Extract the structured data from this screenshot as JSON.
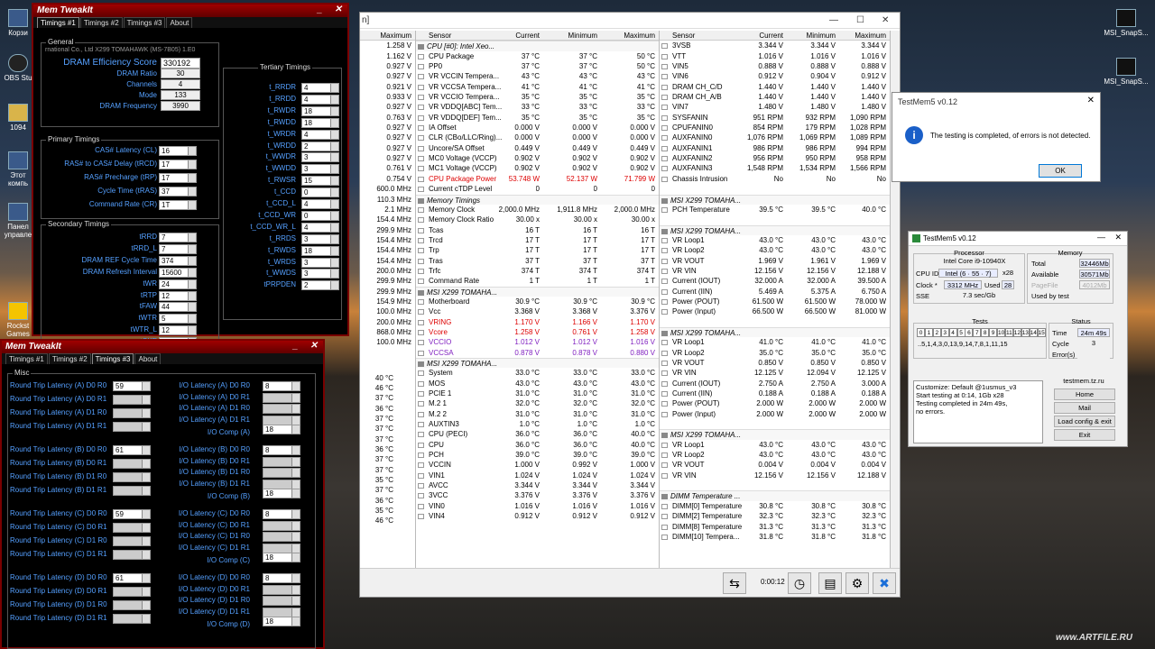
{
  "desktop": {
    "icons": [
      "Корзи",
      "OBS Stu",
      "1094",
      "Этот компь",
      "Панел управле",
      "Rockst Games"
    ],
    "right_icons": [
      "MSI_SnapS...",
      "MSI_SnapS..."
    ],
    "watermark": "www.ARTFILE.RU"
  },
  "hwinfo": {
    "title_frag": "n]",
    "clock": "0:00:12",
    "colA": {
      "hdr": "Maximum",
      "vals": [
        "1.258 V",
        "1.162 V",
        "0.927 V",
        "0.927 V",
        "0.921 V",
        "0.933 V",
        "0.927 V",
        "0.763 V",
        "0.927 V",
        "0.927 V",
        "0.927 V",
        "0.927 V",
        "0.761 V",
        "0.754 V",
        "600.0 MHz",
        "110.3 MHz",
        "2.1 MHz",
        "154.4 MHz",
        "299.9 MHz",
        "154.4 MHz",
        "154.4 MHz",
        "154.4 MHz",
        "200.0 MHz",
        "299.9 MHz",
        "299.9 MHz",
        "154.9 MHz",
        "100.0 MHz",
        "200.0 MHz",
        "868.0 MHz",
        "100.0 MHz"
      ]
    },
    "colA2": [
      "40 °C",
      "46 °C",
      "37 °C",
      "36 °C",
      "37 °C",
      "37 °C",
      "37 °C",
      "36 °C",
      "37 °C",
      "37 °C",
      "35 °C",
      "37 °C",
      "36 °C",
      "35 °C",
      "46 °C"
    ],
    "col1": {
      "hdr": [
        "Sensor",
        "Current",
        "Minimum",
        "Maximum"
      ],
      "rows": [
        {
          "g": "CPU [#0]: Intel Xeo..."
        },
        [
          "CPU Package",
          "37 °C",
          "37 °C",
          "50 °C"
        ],
        [
          "PP0",
          "37 °C",
          "37 °C",
          "50 °C"
        ],
        [
          "VR VCCIN Tempera...",
          "43 °C",
          "43 °C",
          "43 °C"
        ],
        [
          "VR VCCSA Tempera...",
          "41 °C",
          "41 °C",
          "41 °C"
        ],
        [
          "VR VCCIO Tempera...",
          "35 °C",
          "35 °C",
          "35 °C"
        ],
        [
          "VR VDDQ[ABC] Tem...",
          "33 °C",
          "33 °C",
          "33 °C"
        ],
        [
          "VR VDDQ[DEF] Tem...",
          "35 °C",
          "35 °C",
          "35 °C"
        ],
        [
          "IA Offset",
          "0.000 V",
          "0.000 V",
          "0.000 V"
        ],
        [
          "CLR (CBo/LLC/Ring)...",
          "0.000 V",
          "0.000 V",
          "0.000 V"
        ],
        [
          "Uncore/SA Offset",
          "0.449 V",
          "0.449 V",
          "0.449 V"
        ],
        [
          "MC0 Voltage (VCCP)",
          "0.902 V",
          "0.902 V",
          "0.902 V"
        ],
        [
          "MC1 Voltage (VCCP)",
          "0.902 V",
          "0.902 V",
          "0.902 V"
        ],
        {
          "c": "red",
          "r": [
            "CPU Package Power",
            "53.748 W",
            "52.137 W",
            "71.799 W"
          ]
        },
        [
          "Current cTDP Level",
          "0",
          "0",
          "0"
        ],
        {
          "g": "Memory Timings"
        },
        [
          "Memory Clock",
          "2,000.0 MHz",
          "1,911.8 MHz",
          "2,000.0 MHz"
        ],
        [
          "Memory Clock Ratio",
          "30.00 x",
          "30.00 x",
          "30.00 x"
        ],
        [
          "Tcas",
          "16 T",
          "16 T",
          "16 T"
        ],
        [
          "Trcd",
          "17 T",
          "17 T",
          "17 T"
        ],
        [
          "Trp",
          "17 T",
          "17 T",
          "17 T"
        ],
        [
          "Tras",
          "37 T",
          "37 T",
          "37 T"
        ],
        [
          "Trfc",
          "374 T",
          "374 T",
          "374 T"
        ],
        [
          "Command Rate",
          "1 T",
          "1 T",
          "1 T"
        ],
        {
          "g": "MSI X299 TOMAHA..."
        },
        [
          "Motherboard",
          "30.9 °C",
          "30.9 °C",
          "30.9 °C"
        ],
        [
          "Vcc",
          "3.368 V",
          "3.368 V",
          "3.376 V"
        ],
        {
          "c": "red",
          "r": [
            "VRING",
            "1.170 V",
            "1.166 V",
            "1.170 V"
          ]
        },
        {
          "c": "red",
          "r": [
            "Vcore",
            "1.258 V",
            "0.761 V",
            "1.258 V"
          ]
        },
        {
          "c": "pur",
          "r": [
            "VCCIO",
            "1.012 V",
            "1.012 V",
            "1.016 V"
          ]
        },
        {
          "c": "pur",
          "r": [
            "VCCSA",
            "0.878 V",
            "0.878 V",
            "0.880 V"
          ]
        },
        {
          "g": "MSI X299 TOMAHA..."
        },
        [
          "System",
          "33.0 °C",
          "33.0 °C",
          "33.0 °C"
        ],
        [
          "MOS",
          "43.0 °C",
          "43.0 °C",
          "43.0 °C"
        ],
        [
          "PCIE 1",
          "31.0 °C",
          "31.0 °C",
          "31.0 °C"
        ],
        [
          "M.2 1",
          "32.0 °C",
          "32.0 °C",
          "32.0 °C"
        ],
        [
          "M.2 2",
          "31.0 °C",
          "31.0 °C",
          "31.0 °C"
        ],
        [
          "AUXTIN3",
          "1.0 °C",
          "1.0 °C",
          "1.0 °C"
        ],
        [
          "CPU (PECI)",
          "36.0 °C",
          "36.0 °C",
          "40.0 °C"
        ],
        [
          "CPU",
          "36.0 °C",
          "36.0 °C",
          "40.0 °C"
        ],
        [
          "PCH",
          "39.0 °C",
          "39.0 °C",
          "39.0 °C"
        ],
        [
          "VCCIN",
          "1.000 V",
          "0.992 V",
          "1.000 V"
        ],
        [
          "VIN1",
          "1.024 V",
          "1.024 V",
          "1.024 V"
        ],
        [
          "AVCC",
          "3.344 V",
          "3.344 V",
          "3.344 V"
        ],
        [
          "3VCC",
          "3.376 V",
          "3.376 V",
          "3.376 V"
        ],
        [
          "VIN0",
          "1.016 V",
          "1.016 V",
          "1.016 V"
        ],
        [
          "VIN4",
          "0.912 V",
          "0.912 V",
          "0.912 V"
        ]
      ]
    },
    "col2": {
      "hdr": [
        "Sensor",
        "Current",
        "Minimum",
        "Maximum"
      ],
      "rows": [
        [
          "3VSB",
          "3.344 V",
          "3.344 V",
          "3.344 V"
        ],
        [
          "VTT",
          "1.016 V",
          "1.016 V",
          "1.016 V"
        ],
        [
          "VIN5",
          "0.888 V",
          "0.888 V",
          "0.888 V"
        ],
        [
          "VIN6",
          "0.912 V",
          "0.904 V",
          "0.912 V"
        ],
        [
          "DRAM CH_C/D",
          "1.440 V",
          "1.440 V",
          "1.440 V"
        ],
        [
          "DRAM CH_A/B",
          "1.440 V",
          "1.440 V",
          "1.440 V"
        ],
        [
          "VIN7",
          "1.480 V",
          "1.480 V",
          "1.480 V"
        ],
        [
          "SYSFANIN",
          "951 RPM",
          "932 RPM",
          "1,090 RPM"
        ],
        [
          "CPUFANIN0",
          "854 RPM",
          "179 RPM",
          "1,028 RPM"
        ],
        [
          "AUXFANIN0",
          "1,076 RPM",
          "1,069 RPM",
          "1,089 RPM"
        ],
        [
          "AUXFANIN1",
          "986 RPM",
          "986 RPM",
          "994 RPM"
        ],
        [
          "AUXFANIN2",
          "956 RPM",
          "950 RPM",
          "958 RPM"
        ],
        [
          "AUXFANIN3",
          "1,548 RPM",
          "1,534 RPM",
          "1,566 RPM"
        ],
        [
          "Chassis Intrusion",
          "No",
          "No",
          "No"
        ],
        {
          "sp": 1
        },
        {
          "g": "MSI X299 TOMAHA..."
        },
        [
          "PCH Temperature",
          "39.5 °C",
          "39.5 °C",
          "40.0 °C"
        ],
        {
          "sp": 1
        },
        {
          "g": "MSI X299 TOMAHA..."
        },
        [
          "VR Loop1",
          "43.0 °C",
          "43.0 °C",
          "43.0 °C"
        ],
        [
          "VR Loop2",
          "43.0 °C",
          "43.0 °C",
          "43.0 °C"
        ],
        [
          "VR VOUT",
          "1.969 V",
          "1.961 V",
          "1.969 V"
        ],
        [
          "VR VIN",
          "12.156 V",
          "12.156 V",
          "12.188 V"
        ],
        [
          "Current (IOUT)",
          "32.000 A",
          "32.000 A",
          "39.500 A"
        ],
        [
          "Current (IIN)",
          "5.469 A",
          "5.375 A",
          "6.750 A"
        ],
        [
          "Power (POUT)",
          "61.500 W",
          "61.500 W",
          "78.000 W"
        ],
        [
          "Power (Input)",
          "66.500 W",
          "66.500 W",
          "81.000 W"
        ],
        {
          "sp": 1
        },
        {
          "g": "MSI X299 TOMAHA..."
        },
        [
          "VR Loop1",
          "41.0 °C",
          "41.0 °C",
          "41.0 °C"
        ],
        [
          "VR Loop2",
          "35.0 °C",
          "35.0 °C",
          "35.0 °C"
        ],
        [
          "VR VOUT",
          "0.850 V",
          "0.850 V",
          "0.850 V"
        ],
        [
          "VR VIN",
          "12.125 V",
          "12.094 V",
          "12.125 V"
        ],
        [
          "Current (IOUT)",
          "2.750 A",
          "2.750 A",
          "3.000 A"
        ],
        [
          "Current (IIN)",
          "0.188 A",
          "0.188 A",
          "0.188 A"
        ],
        [
          "Power (POUT)",
          "2.000 W",
          "2.000 W",
          "2.000 W"
        ],
        [
          "Power (Input)",
          "2.000 W",
          "2.000 W",
          "2.000 W"
        ],
        {
          "sp": 1
        },
        {
          "g": "MSI X299 TOMAHA..."
        },
        [
          "VR Loop1",
          "43.0 °C",
          "43.0 °C",
          "43.0 °C"
        ],
        [
          "VR Loop2",
          "43.0 °C",
          "43.0 °C",
          "43.0 °C"
        ],
        [
          "VR VOUT",
          "0.004 V",
          "0.004 V",
          "0.004 V"
        ],
        [
          "VR VIN",
          "12.156 V",
          "12.156 V",
          "12.188 V"
        ],
        {
          "sp": 1
        },
        {
          "g": "DIMM Temperature ..."
        },
        [
          "DIMM[0] Temperature",
          "30.8 °C",
          "30.8 °C",
          "30.8 °C"
        ],
        [
          "DIMM[2] Temperature",
          "32.3 °C",
          "32.3 °C",
          "32.3 °C"
        ],
        [
          "DIMM[8] Temperature",
          "31.3 °C",
          "31.3 °C",
          "31.3 °C"
        ],
        [
          "DIMM[10] Tempera...",
          "31.8 °C",
          "31.8 °C",
          "31.8 °C"
        ]
      ]
    }
  },
  "mt1": {
    "title": "Mem TweakIt",
    "tabs": [
      "Timings #1",
      "Timings #2",
      "Timings #3",
      "About"
    ],
    "general_legend": "General",
    "board": "rnational Co., Ltd X299 TOMAHAWK (MS-7B05) 1.E0",
    "general": [
      [
        "DRAM Efficiency Score",
        "330192"
      ],
      [
        "DRAM Ratio",
        "30"
      ],
      [
        "Channels",
        "4"
      ],
      [
        "Mode",
        "133"
      ],
      [
        "DRAM Frequency",
        "3990"
      ]
    ],
    "primary_legend": "Primary Timings",
    "primary": [
      [
        "CAS# Latency (CL)",
        "16"
      ],
      [
        "RAS# to CAS# Delay (tRCD)",
        "17"
      ],
      [
        "RAS# Precharge (tRP)",
        "17"
      ],
      [
        "Cycle Time (tRAS)",
        "37"
      ],
      [
        "Command Rate (CR)",
        "1T"
      ]
    ],
    "secondary_legend": "Secondary Timings",
    "secondary": [
      [
        "tRRD",
        "7"
      ],
      [
        "tRRD_L",
        "7"
      ],
      [
        "DRAM REF Cycle Time",
        "374"
      ],
      [
        "DRAM Refresh Interval",
        "15600"
      ],
      [
        "tWR",
        "24"
      ],
      [
        "tRTP",
        "12"
      ],
      [
        "tFAW",
        "44"
      ],
      [
        "tWTR",
        "5"
      ],
      [
        "tWTR_L",
        "12"
      ],
      [
        "tCKE",
        "8"
      ],
      [
        "tWCL",
        "16"
      ]
    ],
    "tertiary_legend": "Tertiary Timings",
    "tertiary": [
      [
        "t_RRDR",
        "4"
      ],
      [
        "t_RRDD",
        "4"
      ],
      [
        "t_RWDR",
        "18"
      ],
      [
        "t_RWDD",
        "18"
      ],
      [
        "t_WRDR",
        "4"
      ],
      [
        "t_WRDD",
        "2"
      ],
      [
        "t_WWDR",
        "3"
      ],
      [
        "t_WWDD",
        "3"
      ],
      [
        "t_RWSR",
        "15"
      ],
      [
        "t_CCD",
        "0"
      ],
      [
        "t_CCD_L",
        "4"
      ],
      [
        "t_CCD_WR",
        "0"
      ],
      [
        "t_CCD_WR_L",
        "4"
      ],
      [
        "t_RRDS",
        "3"
      ],
      [
        "t_RWDS",
        "18"
      ],
      [
        "t_WRDS",
        "3"
      ],
      [
        "t_WWDS",
        "3"
      ],
      [
        "tPRPDEN",
        "2"
      ]
    ]
  },
  "mt3": {
    "title": "Mem TweakIt",
    "tabs": [
      "Timings #1",
      "Timings #2",
      "Timings #3",
      "About"
    ],
    "misc_legend": "Misc",
    "groups": [
      {
        "rtl": [
          [
            "Round Trip Latency (A) D0 R0",
            "59"
          ],
          [
            "Round Trip Latency (A) D0 R1",
            ""
          ],
          [
            "Round Trip Latency (A) D1 R0",
            ""
          ],
          [
            "Round Trip Latency (A) D1 R1",
            ""
          ]
        ],
        "io": [
          [
            "I/O Latency (A) D0 R0",
            "8"
          ],
          [
            "I/O Latency (A) D0 R1",
            ""
          ],
          [
            "I/O Latency (A) D1 R0",
            ""
          ],
          [
            "I/O Latency (A) D1 R1",
            ""
          ]
        ],
        "comp": [
          "I/O Comp (A)",
          "18"
        ]
      },
      {
        "rtl": [
          [
            "Round Trip Latency (B) D0 R0",
            "61"
          ],
          [
            "Round Trip Latency (B) D0 R1",
            ""
          ],
          [
            "Round Trip Latency (B) D1 R0",
            ""
          ],
          [
            "Round Trip Latency (B) D1 R1",
            ""
          ]
        ],
        "io": [
          [
            "I/O Latency (B) D0 R0",
            "8"
          ],
          [
            "I/O Latency (B) D0 R1",
            ""
          ],
          [
            "I/O Latency (B) D1 R0",
            ""
          ],
          [
            "I/O Latency (B) D1 R1",
            ""
          ]
        ],
        "comp": [
          "I/O Comp (B)",
          "18"
        ]
      },
      {
        "rtl": [
          [
            "Round Trip Latency (C) D0 R0",
            "59"
          ],
          [
            "Round Trip Latency (C) D0 R1",
            ""
          ],
          [
            "Round Trip Latency (C) D1 R0",
            ""
          ],
          [
            "Round Trip Latency (C) D1 R1",
            ""
          ]
        ],
        "io": [
          [
            "I/O Latency (C) D0 R0",
            "8"
          ],
          [
            "I/O Latency (C) D0 R1",
            ""
          ],
          [
            "I/O Latency (C) D1 R0",
            ""
          ],
          [
            "I/O Latency (C) D1 R1",
            ""
          ]
        ],
        "comp": [
          "I/O Comp (C)",
          "18"
        ]
      },
      {
        "rtl": [
          [
            "Round Trip Latency (D) D0 R0",
            "61"
          ],
          [
            "Round Trip Latency (D) D0 R1",
            ""
          ],
          [
            "Round Trip Latency (D) D1 R0",
            ""
          ],
          [
            "Round Trip Latency (D) D1 R1",
            ""
          ]
        ],
        "io": [
          [
            "I/O Latency (D) D0 R0",
            "8"
          ],
          [
            "I/O Latency (D) D0 R1",
            ""
          ],
          [
            "I/O Latency (D) D1 R0",
            ""
          ],
          [
            "I/O Latency (D) D1 R1",
            ""
          ]
        ],
        "comp": [
          "I/O Comp (D)",
          "18"
        ]
      }
    ]
  },
  "dialog": {
    "title": "TestMem5 v0.12",
    "message": "The testing is completed, of errors is not detected.",
    "ok": "OK"
  },
  "tm5": {
    "title": "TestMem5 v0.12",
    "processor_legend": "Processor",
    "cpu_name": "Intel Core i9-10940X",
    "cpu_id_label": "CPU ID",
    "cpu_id": "Intel (6 · 55 · 7)",
    "threads": "x28",
    "clock_label": "Clock *",
    "clock": "3312 MHz",
    "used_label": "Used",
    "used": "28",
    "sse_label": "SSE",
    "sse": "7.3 sec/Gb",
    "memory_legend": "Memory",
    "total_label": "Total",
    "total": "32446Mb",
    "avail_label": "Available",
    "avail": "30571Mb",
    "pagefile_label": "PageFile",
    "pagefile": "4012Mb",
    "usedby_label": "Used by test",
    "usedby": "",
    "tests_legend": "Tests",
    "tests": [
      "0",
      "1",
      "2",
      "3",
      "4",
      "5",
      "6",
      "7",
      "8",
      "9",
      "10",
      "11",
      "12",
      "13",
      "14",
      "15"
    ],
    "sequence": "..5,1,4,3,0,13,9,14,7,8,1,11,15",
    "status_legend": "Status",
    "time_label": "Time",
    "time": "24m 49s",
    "cycle_label": "Cycle",
    "cycle": "3",
    "errors_label": "Error(s)",
    "errors": "",
    "log": [
      "Customize: Default @1usmus_v3",
      "Start testing at 0:14, 1Gb x28",
      "Testing completed in 24m 49s,",
      "no errors."
    ],
    "site": "testmem.tz.ru",
    "buttons": [
      "Home",
      "Mail",
      "Load config & exit",
      "Exit"
    ]
  }
}
